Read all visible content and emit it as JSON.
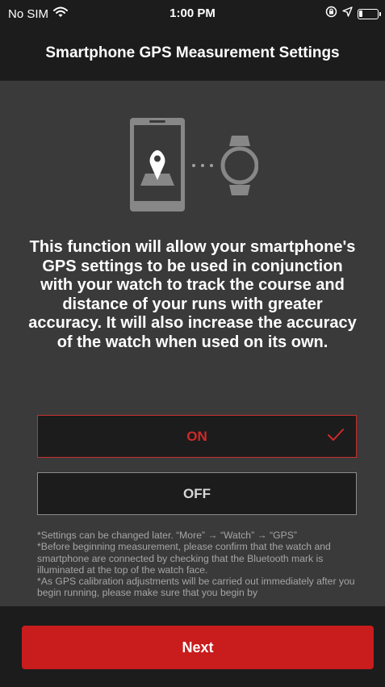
{
  "status_bar": {
    "carrier": "No SIM",
    "time": "1:00 PM"
  },
  "header": {
    "title": "Smartphone GPS Measurement Settings"
  },
  "description": "This function will allow your smartphone's GPS settings to be used in conjunction with your watch to track the course and distance of your runs with greater accuracy. It will also increase the accuracy of the watch when used on its own.",
  "options": {
    "on_label": "ON",
    "off_label": "OFF",
    "selected": "ON"
  },
  "notes": [
    "*Settings can be changed later. “More” → “Watch” → “GPS”",
    "*Before beginning measurement, please confirm that the watch and smartphone are connected by checking that the Bluetooth mark is illuminated at the top of the watch face.",
    "*As GPS calibration adjustments will be carried out immediately after you begin running, please make sure that you begin by"
  ],
  "footer": {
    "next_label": "Next"
  },
  "colors": {
    "accent": "#c91c1c",
    "background": "#3a3a3a",
    "bar": "#1c1c1c"
  },
  "icons": [
    "wifi-icon",
    "orientation-lock-icon",
    "location-arrow-icon",
    "battery-icon",
    "phone-map-pin-icon",
    "watch-icon",
    "checkmark-icon"
  ]
}
